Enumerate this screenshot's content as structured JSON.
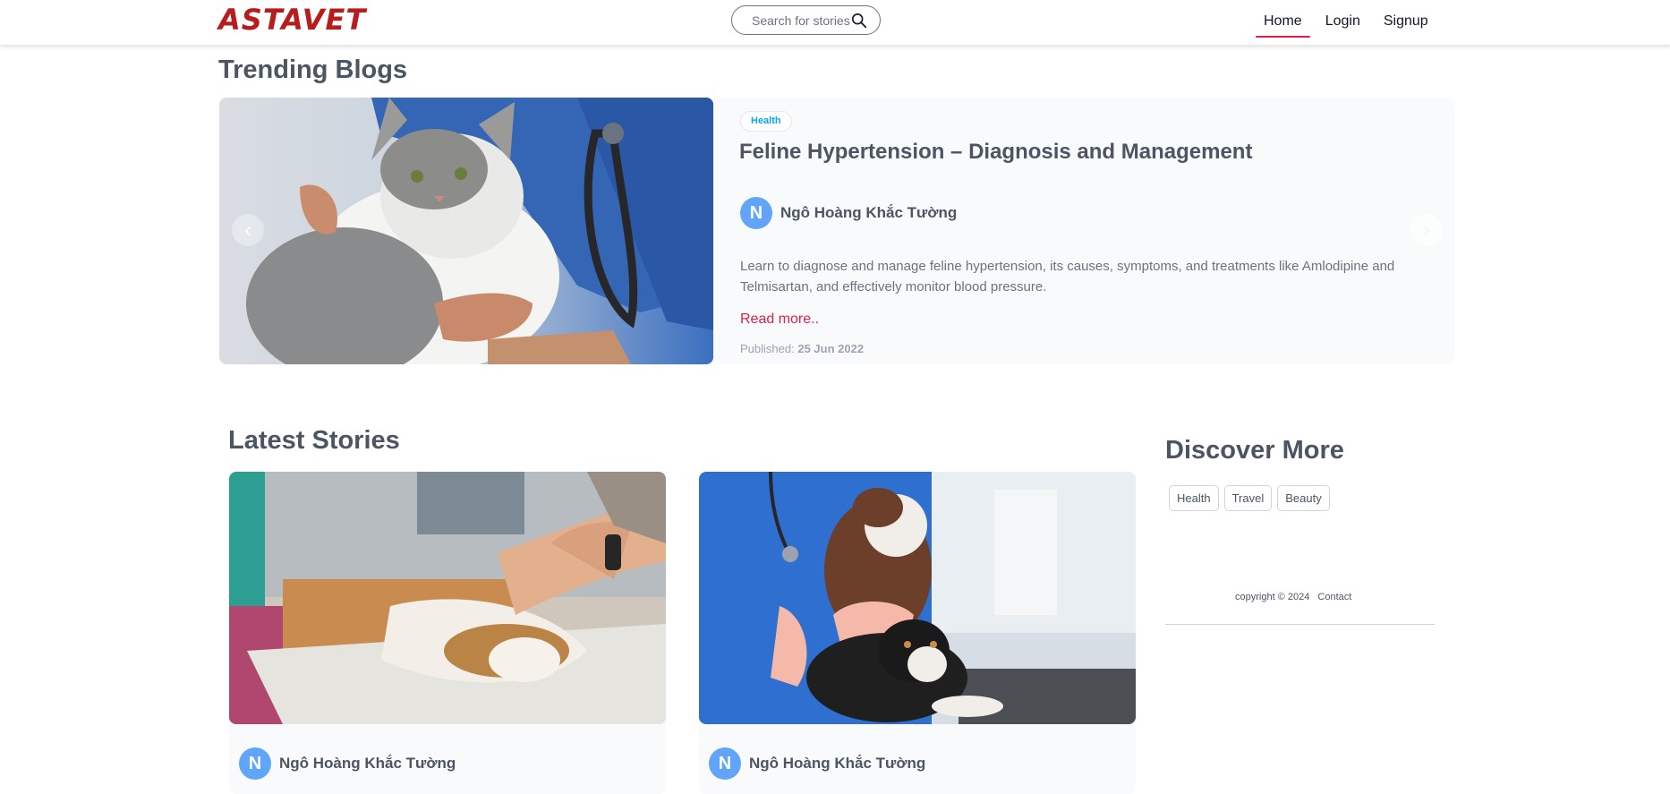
{
  "header": {
    "logo_text": "ASTAVET",
    "search_placeholder": "Search for stories",
    "nav": [
      "Home",
      "Login",
      "Signup"
    ],
    "active_nav": "Home",
    "accent_color": "#e11d48",
    "logo_color": "#b91c1c"
  },
  "trending": {
    "heading": "Trending Blogs",
    "category": "Health",
    "title": "Feline Hypertension – Diagnosis and Management",
    "author_initial": "N",
    "author_name": "Ngô Hoàng Khắc Tường",
    "description": "Learn to diagnose and manage feline hypertension, its causes, symptoms, and treatments like Amlodipine and Telmisartan, and effectively monitor blood pressure.",
    "read_more": "Read more..",
    "published_label": "Published:",
    "published_date": "25 Jun 2022",
    "prev_icon": "chevron-left-icon",
    "next_icon": "chevron-right-icon"
  },
  "latest": {
    "heading": "Latest Stories",
    "cards": [
      {
        "author_initial": "N",
        "author_name": "Ngô Hoàng Khắc Tường"
      },
      {
        "author_initial": "N",
        "author_name": "Ngô Hoàng Khắc Tường"
      }
    ]
  },
  "discover": {
    "heading": "Discover More",
    "tags": [
      "Health",
      "Travel",
      "Beauty"
    ],
    "copyright": "copyright © 2024",
    "contact": "Contact"
  }
}
